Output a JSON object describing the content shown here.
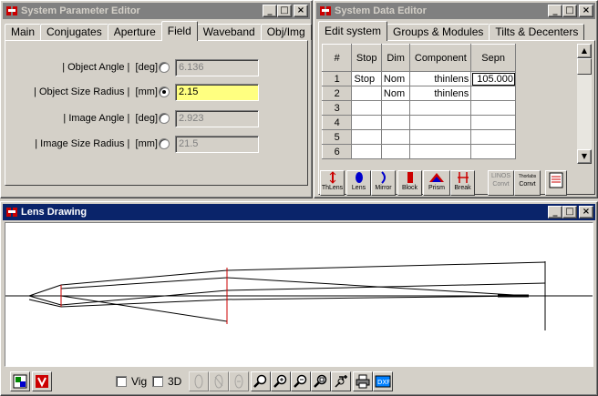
{
  "param_editor": {
    "title": "System Parameter Editor",
    "tabs": [
      "Main",
      "Conjugates",
      "Aperture",
      "Field",
      "Waveband",
      "Obj/Img"
    ],
    "active_tab": "Field",
    "fields": [
      {
        "label": "| Object Angle |",
        "unit": "[deg]",
        "value": "6.136",
        "selected": false
      },
      {
        "label": "| Object Size Radius |",
        "unit": "[mm]",
        "value": "2.15",
        "selected": true
      },
      {
        "label": "| Image Angle |",
        "unit": "[deg]",
        "value": "2.923",
        "selected": false
      },
      {
        "label": "| Image Size Radius |",
        "unit": "[mm]",
        "value": "21.5",
        "selected": false
      }
    ]
  },
  "data_editor": {
    "title": "System Data Editor",
    "tabs": [
      "Edit system",
      "Groups & Modules",
      "Tilts & Decenters"
    ],
    "active_tab": "Edit system",
    "columns": [
      "#",
      "Stop",
      "Dim",
      "Component",
      "Sepn"
    ],
    "rows": [
      {
        "n": "1",
        "stop": "Stop",
        "dim": "Nom",
        "component": "thinlens",
        "sepn": "105.000"
      },
      {
        "n": "2",
        "stop": "",
        "dim": "Nom",
        "component": "thinlens",
        "sepn": ""
      },
      {
        "n": "3",
        "stop": "",
        "dim": "",
        "component": "",
        "sepn": ""
      },
      {
        "n": "4",
        "stop": "",
        "dim": "",
        "component": "",
        "sepn": ""
      },
      {
        "n": "5",
        "stop": "",
        "dim": "",
        "component": "",
        "sepn": ""
      },
      {
        "n": "6",
        "stop": "",
        "dim": "",
        "component": "",
        "sepn": ""
      }
    ],
    "toolbar": [
      {
        "label": "ThLens",
        "icon": "thin-lens-icon"
      },
      {
        "label": "Lens",
        "icon": "lens-icon"
      },
      {
        "label": "Mirror",
        "icon": "mirror-icon"
      },
      {
        "label": "Block",
        "icon": "block-icon"
      },
      {
        "label": "Prism",
        "icon": "prism-icon"
      },
      {
        "label": "Break",
        "icon": "break-icon"
      },
      {
        "label": "Convt",
        "icon": "linos-convert-icon",
        "top": "LINOS",
        "disabled": true
      },
      {
        "label": "Convt",
        "icon": "thorlabs-convert-icon",
        "top": "Thorlabs",
        "disabled": false
      }
    ]
  },
  "lens_drawing": {
    "title": "Lens Drawing",
    "vig_label": "Vig",
    "three_d_label": "3D"
  },
  "colors": {
    "title_active": "#0a246a",
    "title_inactive": "#808080",
    "face": "#d4d0c8",
    "highlight_field": "#ffff80",
    "lens_red": "#cc0000"
  }
}
